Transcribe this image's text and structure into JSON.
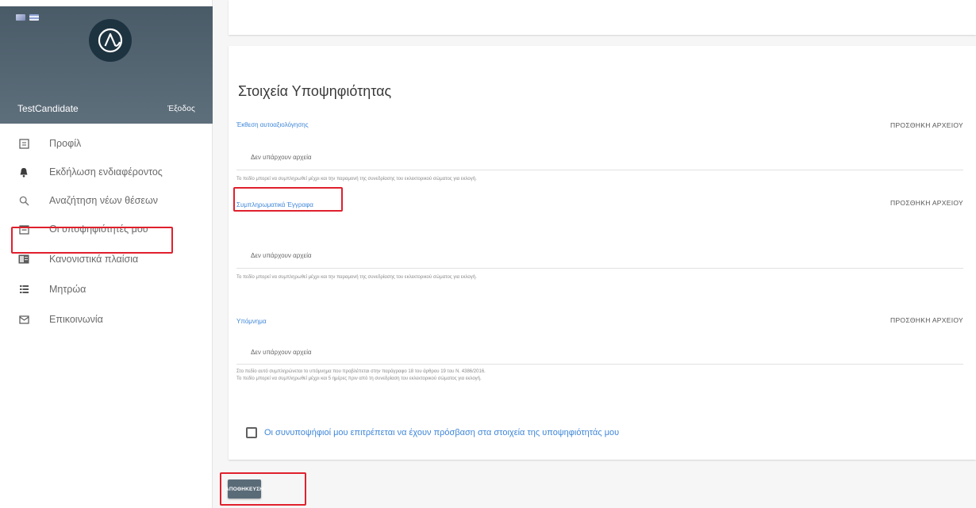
{
  "sidebar": {
    "username": "TestCandidate",
    "logout_label": "Έξοδος",
    "items": [
      {
        "label": "Προφίλ",
        "icon": "profile-icon"
      },
      {
        "label": "Εκδήλωση ενδιαφέροντος",
        "icon": "bell-icon"
      },
      {
        "label": "Αναζήτηση νέων θέσεων",
        "icon": "search-icon"
      },
      {
        "label": "Οι υποψηφιότητές μου",
        "icon": "calendar-icon"
      },
      {
        "label": "Κανονιστικά πλαίσια",
        "icon": "regulation-icon"
      },
      {
        "label": "Μητρώα",
        "icon": "list-icon"
      },
      {
        "label": "Επικοινωνία",
        "icon": "mail-icon"
      }
    ]
  },
  "main": {
    "section_title": "Στοιχεία Υποψηφιότητας",
    "fields": [
      {
        "label": "Έκθεση αυτοαξιολόγησης",
        "attach_label": "ΠΡΟΣΘΗΚΗ ΑΡΧΕΙΟΥ",
        "empty_text": "Δεν υπάρχουν αρχεία",
        "help_lines": [
          "Το πεδίο μπορεί να συμπληρωθεί μέχρι και την παραμονή της συνεδρίασης του εκλεκτορικού σώματος για εκλογή."
        ]
      },
      {
        "label": "Συμπληρωματικά Έγγραφα",
        "attach_label": "ΠΡΟΣΘΗΚΗ ΑΡΧΕΙΟΥ",
        "empty_text": "Δεν υπάρχουν αρχεία",
        "help_lines": [
          "Το πεδίο μπορεί να συμπληρωθεί μέχρι και την παραμονή της συνεδρίασης του εκλεκτορικού σώματος για εκλογή."
        ]
      },
      {
        "label": "Υπόμνημα",
        "attach_label": "ΠΡΟΣΘΗΚΗ ΑΡΧΕΙΟΥ",
        "empty_text": "Δεν υπάρχουν αρχεία",
        "help_lines": [
          "Στο πεδίο αυτό συμπληρώνεται το υπόμνημα που προβλέπεται στην παράγραφο 18 του άρθρου 19 του Ν. 4386/2016.",
          "Το πεδίο μπορεί να συμπληρωθεί μέχρι και 5 ημέρες πριν από τη συνεδρίαση του εκλεκτορικού σώματος για εκλογή."
        ]
      }
    ],
    "checkbox_label": "Οι συνυποψήφιοί μου επιτρέπεται να έχουν πρόσβαση στα στοιχεία της υποψηφιότητάς μου",
    "checkbox_checked": false,
    "save_label": "ΑΠΟΘΗΚΕΥΣΗ"
  },
  "colors": {
    "link_blue": "#3e86d8",
    "highlight_red": "#e0202d",
    "header_slate": "#5a6b78"
  }
}
